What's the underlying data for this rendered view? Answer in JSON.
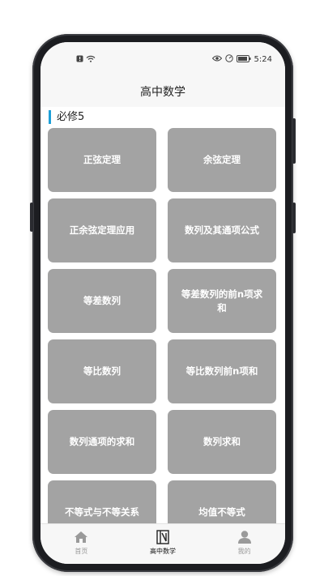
{
  "status_bar": {
    "time": "5:24",
    "icons": [
      "notification-icon",
      "wifi-icon",
      "eye-icon",
      "speed-icon",
      "battery-icon"
    ]
  },
  "header": {
    "title": "高中数学"
  },
  "section": {
    "title": "必修5",
    "accent_color": "#1ea0d8"
  },
  "topics": [
    {
      "label": "正弦定理"
    },
    {
      "label": "余弦定理"
    },
    {
      "label": "正余弦定理应用"
    },
    {
      "label": "数列及其通项公式"
    },
    {
      "label": "等差数列"
    },
    {
      "label": "等差数列的前n项求和"
    },
    {
      "label": "等比数列"
    },
    {
      "label": "等比数列前n项和"
    },
    {
      "label": "数列通项的求和"
    },
    {
      "label": "数列求和"
    },
    {
      "label": "不等式与不等关系"
    },
    {
      "label": "均值不等式"
    }
  ],
  "tile_color": "#a3a3a3",
  "bottom_nav": {
    "items": [
      {
        "label": "首页",
        "icon": "home-icon",
        "active": false
      },
      {
        "label": "高中数学",
        "icon": "book-icon",
        "active": true
      },
      {
        "label": "我的",
        "icon": "user-icon",
        "active": false
      }
    ]
  }
}
